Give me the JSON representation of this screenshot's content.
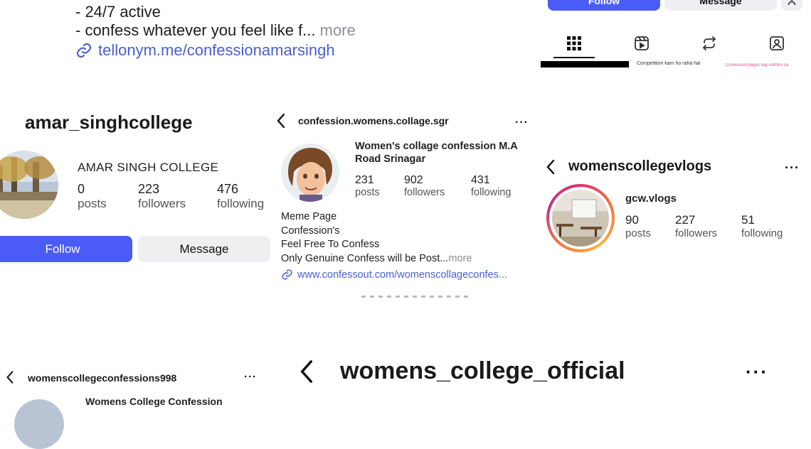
{
  "top_left_bio": {
    "line1": "- 24/7 active",
    "line2": "- confess whatever you feel like f...",
    "more": "more",
    "link": "tellonym.me/confessionamarsingh"
  },
  "top_right": {
    "follow_label": "Follow",
    "message_label": "Message",
    "tabs": [
      "grid-icon",
      "reels-icon",
      "reposts-icon",
      "tagged-icon"
    ],
    "thumb_text_1": "Competition kam ho raha hai",
    "thumb_text_2": "Confession pages kay Admins ca"
  },
  "amar": {
    "username": "amar_singhcollege",
    "full_name": "AMAR SINGH COLLEGE",
    "posts_num": "0",
    "posts_lbl": "posts",
    "followers_num": "223",
    "followers_lbl": "followers",
    "following_num": "476",
    "following_lbl": "following",
    "follow_label": "Follow",
    "message_label": "Message"
  },
  "womens_confession": {
    "username": "confession.womens.collage.sgr",
    "full_name": "Women's collage confession M.A Road Srinagar",
    "posts_num": "231",
    "posts_lbl": "posts",
    "followers_num": "902",
    "followers_lbl": "followers",
    "following_num": "431",
    "following_lbl": "following",
    "bio": [
      "Meme Page",
      "Confession's",
      "Feel Free To Confess",
      "Only Genuine Confess will be Post..."
    ],
    "more": "more",
    "link": "www.confessout.com/womenscollageconfes..."
  },
  "vlogs": {
    "username": "womenscollegevlogs",
    "full_name": "gcw.vlogs",
    "posts_num": "90",
    "posts_lbl": "posts",
    "followers_num": "227",
    "followers_lbl": "followers",
    "following_num": "51",
    "following_lbl": "following"
  },
  "confessions998": {
    "username": "womenscollegeconfessions998",
    "full_name": "Womens College Confession"
  },
  "official": {
    "username": "womens_college_official"
  },
  "colors": {
    "accent": "#4a5cf5",
    "link": "#4a5fd1"
  }
}
